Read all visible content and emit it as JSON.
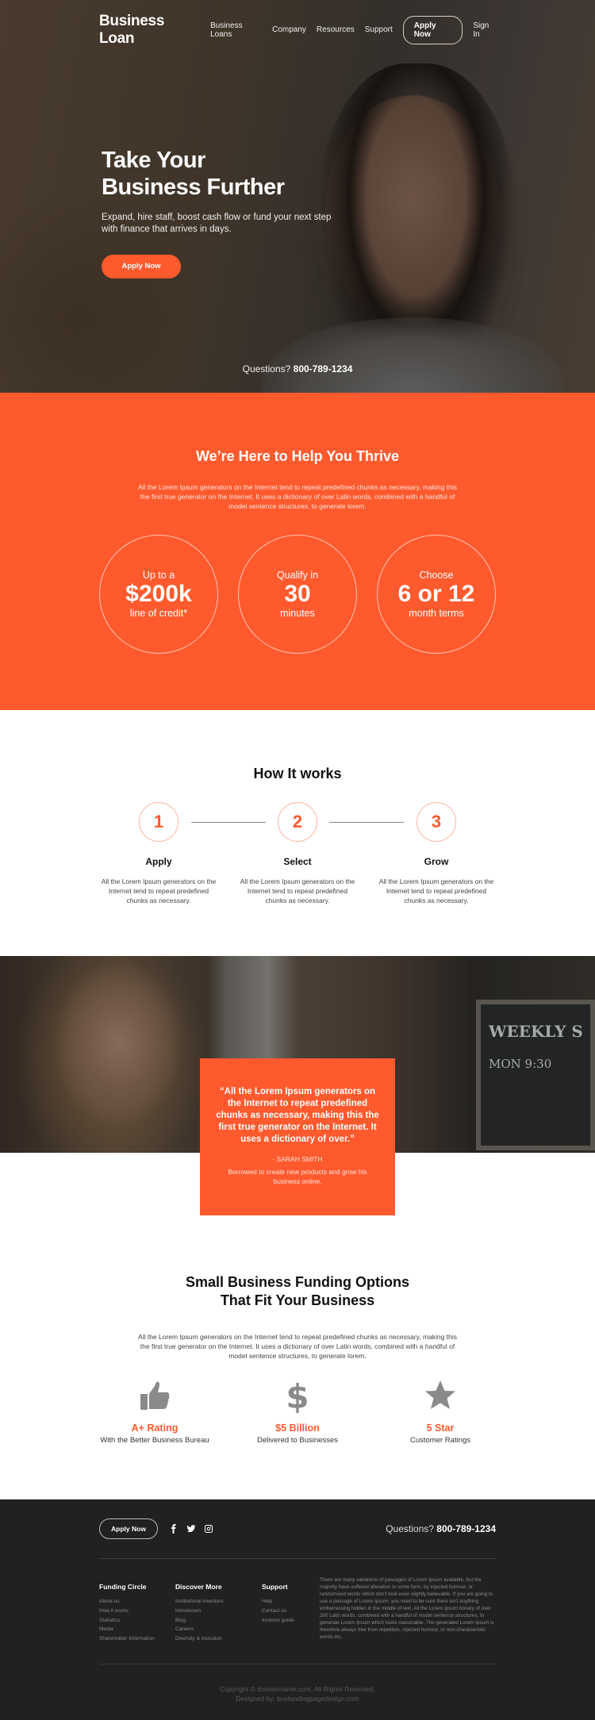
{
  "nav": {
    "logo": "Business Loan",
    "links": [
      "Business Loans",
      "Company",
      "Resources",
      "Support"
    ],
    "apply_label": "Apply Now",
    "signin_label": "Sign In"
  },
  "hero": {
    "title_line1": "Take Your",
    "title_line2": "Business Further",
    "subtitle": "Expand, hire staff, boost cash flow or fund your next step with finance that arrives in days.",
    "cta_label": "Apply Now",
    "phone_prefix": "Questions?",
    "phone": "800-789-1234"
  },
  "thrive": {
    "title": "We’re Here to Help You Thrive",
    "paragraph": "All the Lorem Ipsum generators on the Internet tend to repeat predefined chunks as necessary, making this the first true generator on the Internet. It uses a dictionary of over Latin words, combined with a handful of model sentence structures, to generate lorem.",
    "stats": [
      {
        "top": "Up to a",
        "big": "$200k",
        "bottom": "line of credit*"
      },
      {
        "top": "Qualify in",
        "big": "30",
        "bottom": "minutes"
      },
      {
        "top": "Choose",
        "big": "6 or 12",
        "bottom": "month terms"
      }
    ]
  },
  "how": {
    "title": "How It works",
    "steps": [
      {
        "num": "1",
        "name": "Apply",
        "text": "All the Lorem Ipsum generators on the Internet tend to repeat predefined chunks as necessary."
      },
      {
        "num": "2",
        "name": "Select",
        "text": "All the Lorem Ipsum generators on the Internet tend to repeat predefined chunks as necessary."
      },
      {
        "num": "3",
        "name": "Grow",
        "text": "All the Lorem Ipsum generators on the Internet tend to repeat predefined chunks as necessary."
      }
    ]
  },
  "testimonial": {
    "quote": "“All the Lorem Ipsum generators on the Internet to repeat predefined chunks as necessary, making this the first true generator on the Internet. It uses a dictionary of over.”",
    "author": "- SARAH SMITH",
    "note": "Borrowed to create new products and grow his business online.",
    "sign_line1": "WEEKLY S",
    "sign_line2": "MON  9:30"
  },
  "funding": {
    "title_line1": "Small Business Funding Options",
    "title_line2": "That Fit Your Business",
    "paragraph": "All the Lorem Ipsum generators on the Internet tend to repeat predefined chunks as necessary, making this the first true generator on the Internet. It uses a dictionary of over Latin words, combined with a handful of model sentence structures, to generate lorem.",
    "features": [
      {
        "icon": "thumbs-up-icon",
        "title": "A+ Rating",
        "subtitle": "With the Better Business Bureau"
      },
      {
        "icon": "dollar-icon",
        "title": "$5 Billion",
        "subtitle": "Delivered to Businesses"
      },
      {
        "icon": "star-icon",
        "title": "5 Star",
        "subtitle": "Customer Ratings"
      }
    ],
    "accent": "#ff5a2e"
  },
  "footer": {
    "apply_label": "Apply Now",
    "social_icons": [
      "facebook-icon",
      "twitter-icon",
      "instagram-icon"
    ],
    "phone_prefix": "Questions?",
    "phone": "800-789-1234",
    "columns": [
      {
        "title": "Funding Circle",
        "links": [
          "About us",
          "How it works",
          "Statistics",
          "Media",
          "Shareholder Information"
        ]
      },
      {
        "title": "Discover More",
        "links": [
          "Institutional investors",
          "Introducers",
          "Blog",
          "Careers",
          "Diversity & Inclusion"
        ]
      },
      {
        "title": "Support",
        "links": [
          "Help",
          "Contact us",
          "Investor guide"
        ]
      }
    ],
    "paragraph": "There are many variations of passages of Lorem Ipsum available, but the majority have suffered alteration in some form, by injected humour, or randomised words which don't look even slightly believable. If you are going to use a passage of Lorem Ipsum, you need to be sure there isn't anything embarrassing hidden in the middle of text. All the Lorem Ipsum tionary of over 200 Latin words, combined with a handful of model sentence structures, to generate Lorem Ipsum which looks reasonable. The generated Lorem Ipsum is therefore always free from repetition, injected humour, or non-characteristic words etc.",
    "copyright": "Copyright © domainname.com. All Rights Reserved.",
    "designed_by": "Designed by: buylandingpagedesign.com"
  }
}
